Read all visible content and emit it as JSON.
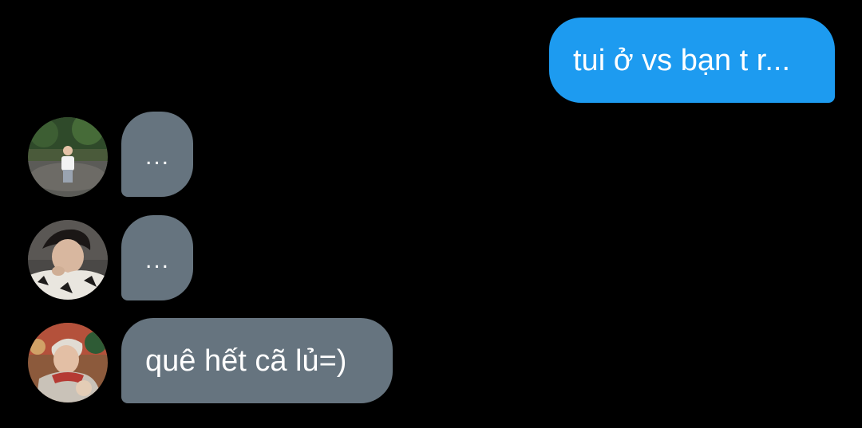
{
  "conversation": {
    "messages": [
      {
        "direction": "outgoing",
        "text": "tui ở vs bạn t r..."
      },
      {
        "direction": "incoming",
        "text": "..."
      },
      {
        "direction": "incoming",
        "text": "..."
      },
      {
        "direction": "incoming",
        "text": "quê hết cã lủ=)"
      }
    ]
  },
  "colors": {
    "background": "#000000",
    "outgoing_bubble": "#1d9bf0",
    "incoming_bubble": "#66747f",
    "text": "#ffffff"
  }
}
